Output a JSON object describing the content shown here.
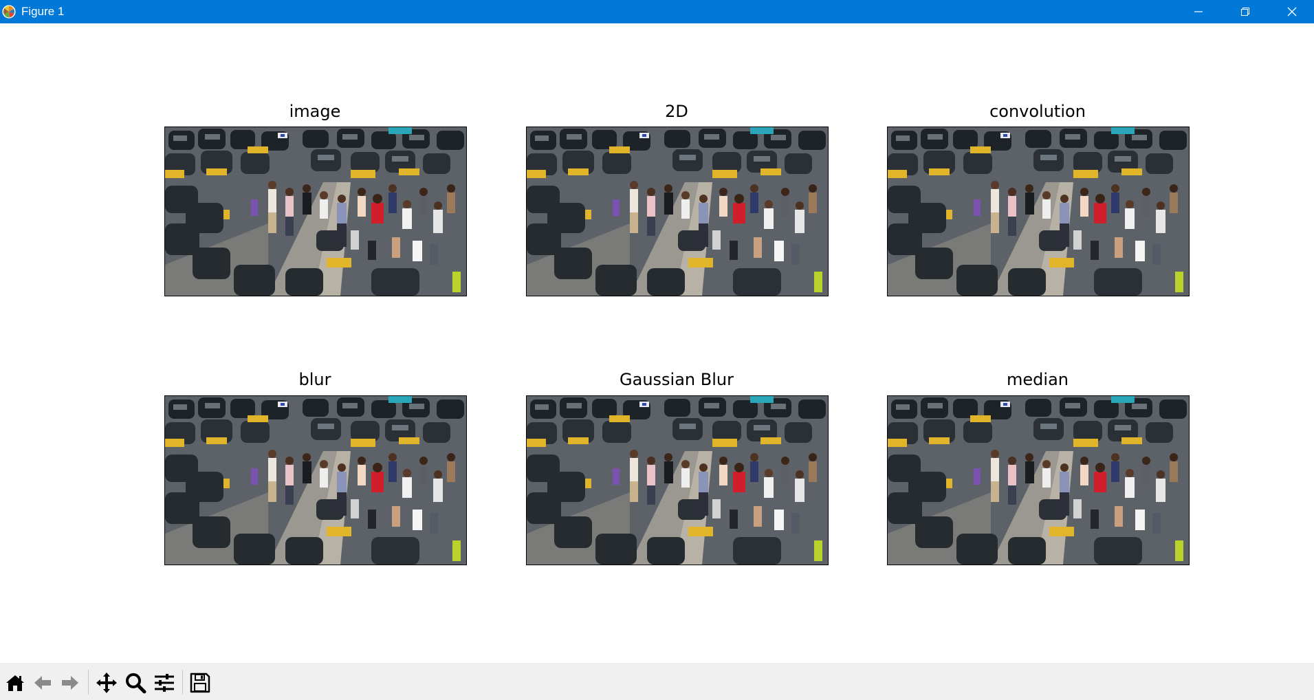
{
  "window": {
    "title": "Figure 1",
    "controls": [
      "minimize",
      "maximize",
      "close"
    ]
  },
  "figure": {
    "subplots": [
      {
        "title": "image"
      },
      {
        "title": "2D"
      },
      {
        "title": "convolution"
      },
      {
        "title": "blur"
      },
      {
        "title": "Gaussian Blur"
      },
      {
        "title": "median"
      }
    ]
  },
  "toolbar": {
    "buttons": [
      "home-icon",
      "back-icon",
      "forward-icon",
      "pan-icon",
      "zoom-icon",
      "configure-subplots-icon",
      "save-icon"
    ]
  },
  "colors": {
    "titlebar": "#0078d7",
    "toolbar": "#f0f0f0"
  }
}
